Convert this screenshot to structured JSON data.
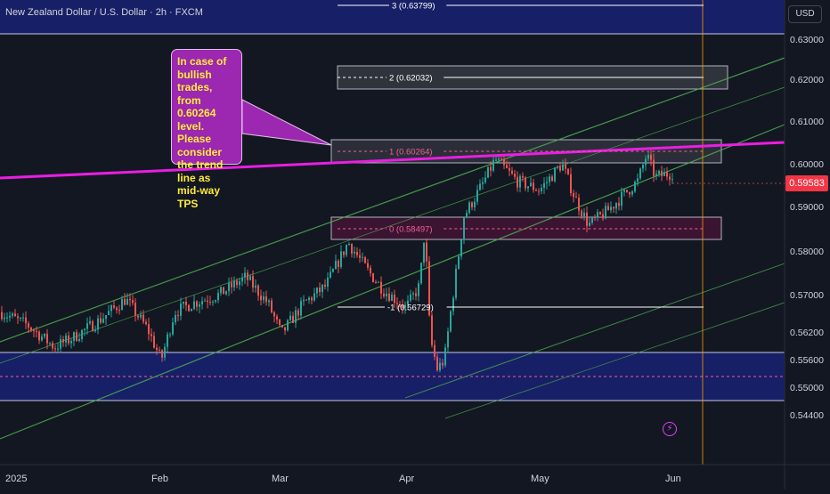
{
  "header": {
    "symbol_title": "New Zealand Dollar / U.S. Dollar · 2h · FXCM"
  },
  "currency_button": "USD",
  "current_price": {
    "label": "0.59583",
    "value": 0.59583,
    "color": "#f23645"
  },
  "callout": {
    "text": "In case of bullish trades, from 0.60264 level. Please consider the trend line as mid-way TPS"
  },
  "price_axis": {
    "ticks": [
      {
        "label": "0.63000",
        "value": 0.63
      },
      {
        "label": "0.62000",
        "value": 0.62
      },
      {
        "label": "0.61000",
        "value": 0.61
      },
      {
        "label": "0.60000",
        "value": 0.6
      },
      {
        "label": "0.59000",
        "value": 0.59
      },
      {
        "label": "0.58000",
        "value": 0.58
      },
      {
        "label": "0.57000",
        "value": 0.57
      },
      {
        "label": "0.56200",
        "value": 0.562
      },
      {
        "label": "0.55600",
        "value": 0.556
      },
      {
        "label": "0.55000",
        "value": 0.55
      },
      {
        "label": "0.54400",
        "value": 0.544
      }
    ]
  },
  "time_axis": {
    "ticks": [
      {
        "label": "2025",
        "bar": 0
      },
      {
        "label": "Feb",
        "bar": 1
      },
      {
        "label": "Mar",
        "bar": 2
      },
      {
        "label": "Apr",
        "bar": 3
      },
      {
        "label": "May",
        "bar": 4
      },
      {
        "label": "Jun",
        "bar": 5
      }
    ]
  },
  "fib_levels": [
    {
      "label": "3 (0.63799)",
      "value": 0.63799,
      "color": "#ffffff"
    },
    {
      "label": "2 (0.62032)",
      "value": 0.62032,
      "color": "#ffffff"
    },
    {
      "label": "1 (0.60264)",
      "value": 0.60264,
      "color": "#f06292"
    },
    {
      "label": "0 (0.58497)",
      "value": 0.58497,
      "color": "#f06292"
    },
    {
      "label": "-1 (0.56729)",
      "value": 0.56729,
      "color": "#ffffff"
    }
  ],
  "colors": {
    "background": "#131722",
    "zone_fill": "#1a237e",
    "trendline": "#e91ee3",
    "channel": "#4caf50",
    "candle_up": "#26a69a",
    "candle_down": "#ef5350",
    "callout_fill": "#9c27b0",
    "callout_text": "#ffeb3b"
  }
}
